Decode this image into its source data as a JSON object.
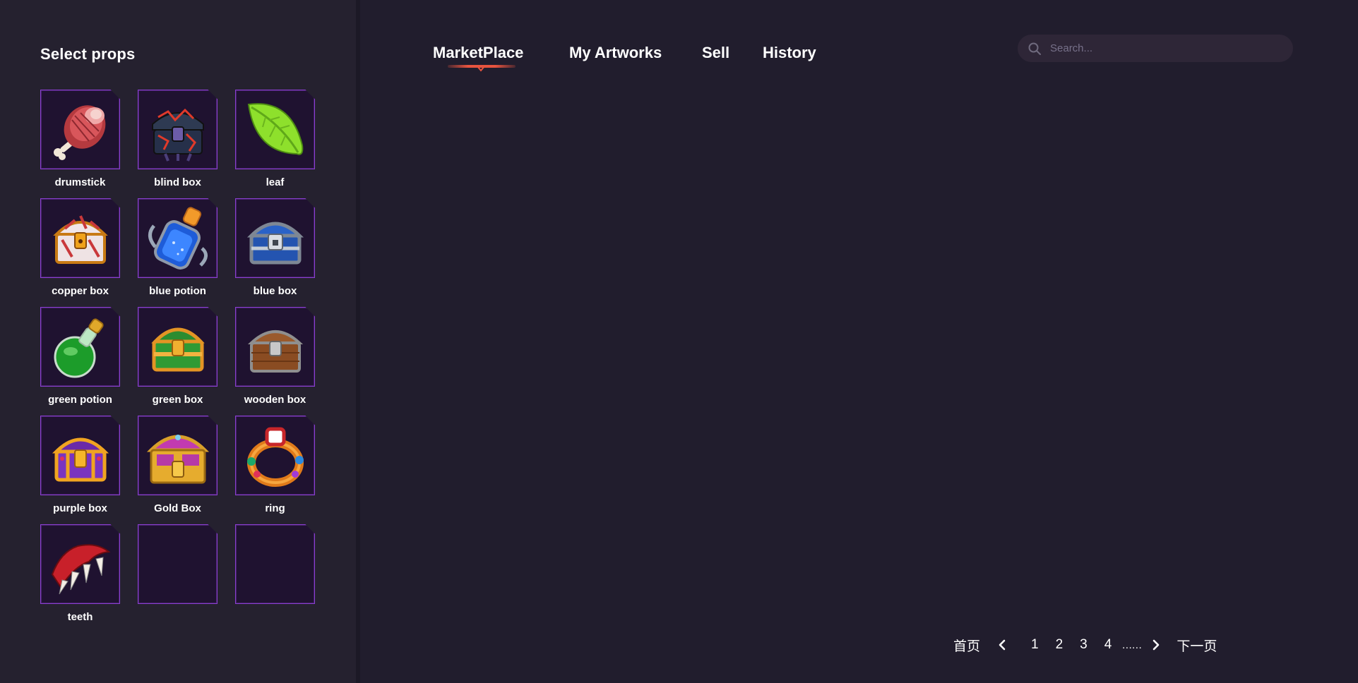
{
  "sidebar": {
    "title": "Select props",
    "props": [
      {
        "label": "drumstick",
        "icon": "drumstick-icon"
      },
      {
        "label": "blind box",
        "icon": "blind-box-icon"
      },
      {
        "label": "leaf",
        "icon": "leaf-icon"
      },
      {
        "label": "copper box",
        "icon": "copper-box-icon"
      },
      {
        "label": "blue potion",
        "icon": "blue-potion-icon"
      },
      {
        "label": "blue box",
        "icon": "blue-box-icon"
      },
      {
        "label": "green potion",
        "icon": "green-potion-icon"
      },
      {
        "label": "green box",
        "icon": "green-box-icon"
      },
      {
        "label": "wooden box",
        "icon": "wooden-box-icon"
      },
      {
        "label": "purple box",
        "icon": "purple-box-icon"
      },
      {
        "label": "Gold Box",
        "icon": "gold-box-icon"
      },
      {
        "label": "ring",
        "icon": "ring-icon"
      },
      {
        "label": "teeth",
        "icon": "teeth-icon"
      },
      {
        "label": "",
        "icon": ""
      },
      {
        "label": "",
        "icon": ""
      }
    ]
  },
  "nav": {
    "tabs": [
      {
        "label": "MarketPlace",
        "active": true
      },
      {
        "label": "My Artworks",
        "active": false
      },
      {
        "label": "Sell",
        "active": false
      },
      {
        "label": "History",
        "active": false
      }
    ]
  },
  "search": {
    "placeholder": "Search...",
    "value": ""
  },
  "pagination": {
    "first_label": "首页",
    "pages": [
      "1",
      "2",
      "3",
      "4"
    ],
    "ellipsis": "……",
    "next_label": "下一页"
  },
  "colors": {
    "background": "#211d2d",
    "sidebar": "#25212f",
    "tile_border": "#8a3fd1",
    "tile_fill": "#1f1230",
    "accent": "#e8543f"
  }
}
